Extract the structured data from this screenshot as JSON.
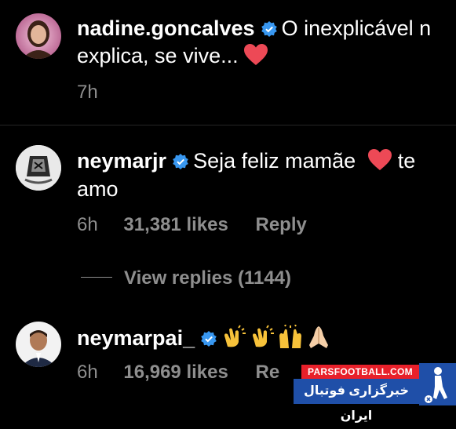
{
  "comments": [
    {
      "username": "nadine.goncalves",
      "text_line1": "O inexplicável n",
      "text_line2": "explica, se vive...",
      "time": "7h"
    },
    {
      "username": "neymarjr",
      "text_line1": "Seja feliz mamãe",
      "text_after_heart": "te",
      "text_line2": "amo",
      "time": "6h",
      "likes": "31,381 likes",
      "reply": "Reply",
      "view_replies": "View replies (1144)"
    },
    {
      "username": "neymarpai_",
      "time": "6h",
      "likes": "16,969 likes",
      "reply": "Re",
      "emojis": [
        "clapping-hands",
        "clapping-hands",
        "raising-hands",
        "folded-hands"
      ]
    }
  ],
  "watermark": {
    "site": "PARSFOOTBALL.COM",
    "tagline": "خبرگزاری فوتبال ایران"
  },
  "colors": {
    "background": "#000000",
    "secondary_text": "#8e8e8e",
    "verified_blue": "#3897f0",
    "heart_red": "#ed4956",
    "watermark_blue": "#1f4fa8",
    "watermark_red": "#e8202a"
  }
}
